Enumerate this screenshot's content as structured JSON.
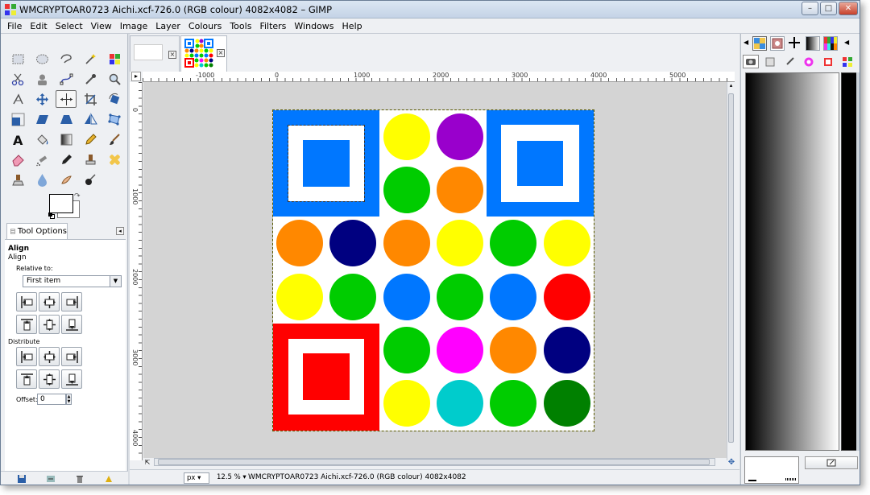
{
  "window": {
    "title": "WMCRYPTOAR0723 Aichi.xcf-726.0 (RGB colour) 4082x4082 – GIMP",
    "minimize": "–",
    "maximize": "□",
    "close": "✕"
  },
  "menu": [
    "File",
    "Edit",
    "Select",
    "View",
    "Image",
    "Layer",
    "Colours",
    "Tools",
    "Filters",
    "Windows",
    "Help"
  ],
  "tool_icons": [
    "rect-select-icon",
    "ellipse-select-icon",
    "free-select-icon",
    "fuzzy-select-icon",
    "by-color-select-icon",
    "scissors-select-icon",
    "foreground-select-icon",
    "paths-icon",
    "color-picker-icon",
    "zoom-icon",
    "measure-icon",
    "move-icon",
    "align-icon",
    "crop-icon",
    "rotate-icon",
    "scale-icon",
    "shear-icon",
    "perspective-icon",
    "flip-icon",
    "cage-transform-icon",
    "text-icon",
    "bucket-fill-icon",
    "blend-icon",
    "pencil-icon",
    "paintbrush-icon",
    "eraser-icon",
    "airbrush-icon",
    "ink-icon",
    "clone-icon",
    "heal-icon",
    "perspective-clone-icon",
    "blur-icon",
    "smudge-icon",
    "dodge-burn-icon"
  ],
  "tool_options": {
    "tab_label": "Tool Options",
    "title": "Align",
    "subtitle": "Align",
    "relative_to_label": "Relative to:",
    "relative_to_value": "First item",
    "distribute_label": "Distribute",
    "offset_label": "Offset:",
    "offset_value": "0"
  },
  "rulers": {
    "horizontal": [
      "-1000",
      "0",
      "1000",
      "2000",
      "3000",
      "4000",
      "5000"
    ],
    "vertical": [
      "0",
      "1000",
      "2000",
      "3000",
      "4000"
    ]
  },
  "status": {
    "unit": "px",
    "zoom": "12.5 %",
    "info": "WMCRYPTOAR0723 Aichi.xcf-726.0 (RGB colour) 4082x4082"
  },
  "colors": {
    "blue": "#0077ff",
    "yellow": "#ffff00",
    "purple": "#9900cc",
    "green": "#00cc00",
    "orange": "#ff8800",
    "navy": "#000080",
    "red": "#ff0000",
    "magenta": "#ff00ff",
    "cyan": "#00cccc",
    "dark_green": "#008000"
  }
}
